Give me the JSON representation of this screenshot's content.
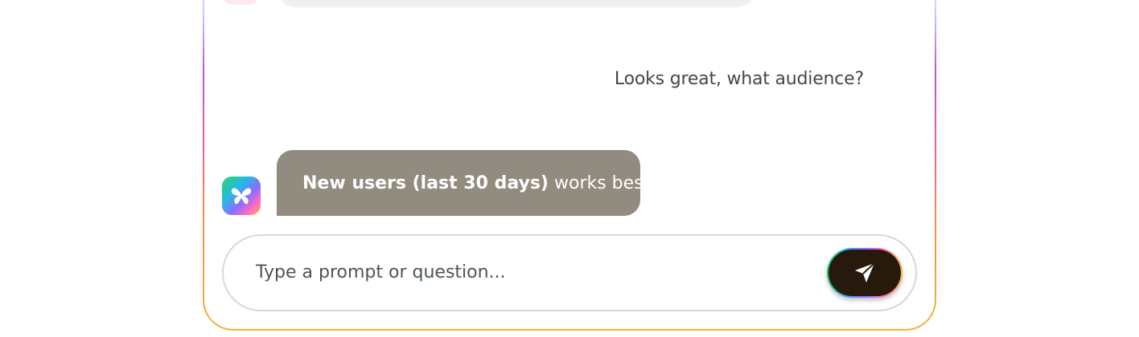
{
  "conversation": {
    "user_message": "Looks great, what audience?",
    "assistant_message_bold": "New users (last 30 days)",
    "assistant_message_rest": " works best."
  },
  "composer": {
    "placeholder": "Type a prompt or question...",
    "send_icon": "send-icon"
  },
  "icons": {
    "assistant_avatar": "butterfly-icon"
  },
  "colors": {
    "assistant_bubble": "#928b7f",
    "send_button": "#271a0c",
    "frame_gradient_start": "#c9b4ff",
    "frame_gradient_end": "#f5b33a"
  }
}
